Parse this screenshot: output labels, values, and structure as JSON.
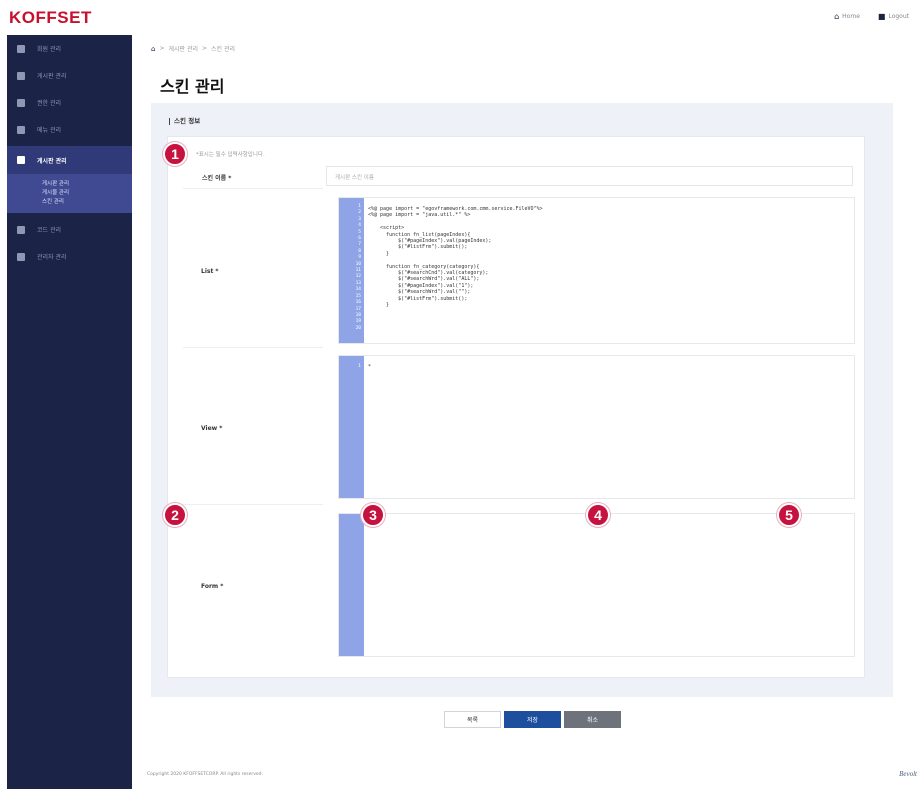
{
  "brand": {
    "logo": "KOFFSET"
  },
  "header": {
    "home_label": "Home",
    "logout_label": "Logout"
  },
  "sidebar": {
    "items": [
      {
        "label": "회원 관리"
      },
      {
        "label": "게시판 관리"
      },
      {
        "label": "권한 관리"
      },
      {
        "label": "메뉴 관리"
      },
      {
        "label": "게시판 관리",
        "active": true
      },
      {
        "label": "코드 관리"
      },
      {
        "label": "관리자 관리"
      }
    ],
    "subitems": [
      "게시판 관리",
      "게시물 관리",
      "스킨 관리"
    ]
  },
  "breadcrumb": [
    "게시판 관리",
    "스킨 관리"
  ],
  "page": {
    "title": "스킨 관리",
    "section_title": "스킨 정보",
    "required_note": "*표시는 필수 입력사항입니다."
  },
  "form": {
    "name_label": "스킨 이름 *",
    "name_placeholder": "게시판 스킨 이름",
    "list_label": "List *",
    "view_label": "View *",
    "form_label": "Form *",
    "list_code": [
      "<%@ page import = \"egovframework.com.cmm.service.FileVO\"%>",
      "<%@ page import = \"java.util.*\" %>",
      "",
      "    <script>",
      "      function fn_list(pageIndex){",
      "          $(\"#pageIndex\").val(pageIndex);",
      "          $(\"#listFrm\").submit();",
      "      }",
      "",
      "      function fn_category(category){",
      "          $(\"#searchCnd\").val(category);",
      "          $(\"#searchWrd\").val(\"ALL\");",
      "          $(\"#pageIndex\").val(\"1\");",
      "          $(\"#searchWrd\").val(\"\");",
      "          $(\"#listFrm\").submit();",
      "      }"
    ],
    "view_code": [
      "*"
    ],
    "form_code": []
  },
  "badges": [
    "1",
    "2",
    "3",
    "4",
    "5"
  ],
  "buttons": {
    "list": "목록",
    "save": "저장",
    "cancel": "취소"
  },
  "footer": {
    "copyright": "Copyright 2020 KFOFFSETCORP. All rights reserved.",
    "brand": "Bevolt"
  },
  "colors": {
    "brand_red": "#c8102e",
    "sidebar_bg": "#1b2347",
    "gutter": "#8ea4e6",
    "badge": "#c5123f",
    "primary_btn": "#1d4f9e"
  }
}
